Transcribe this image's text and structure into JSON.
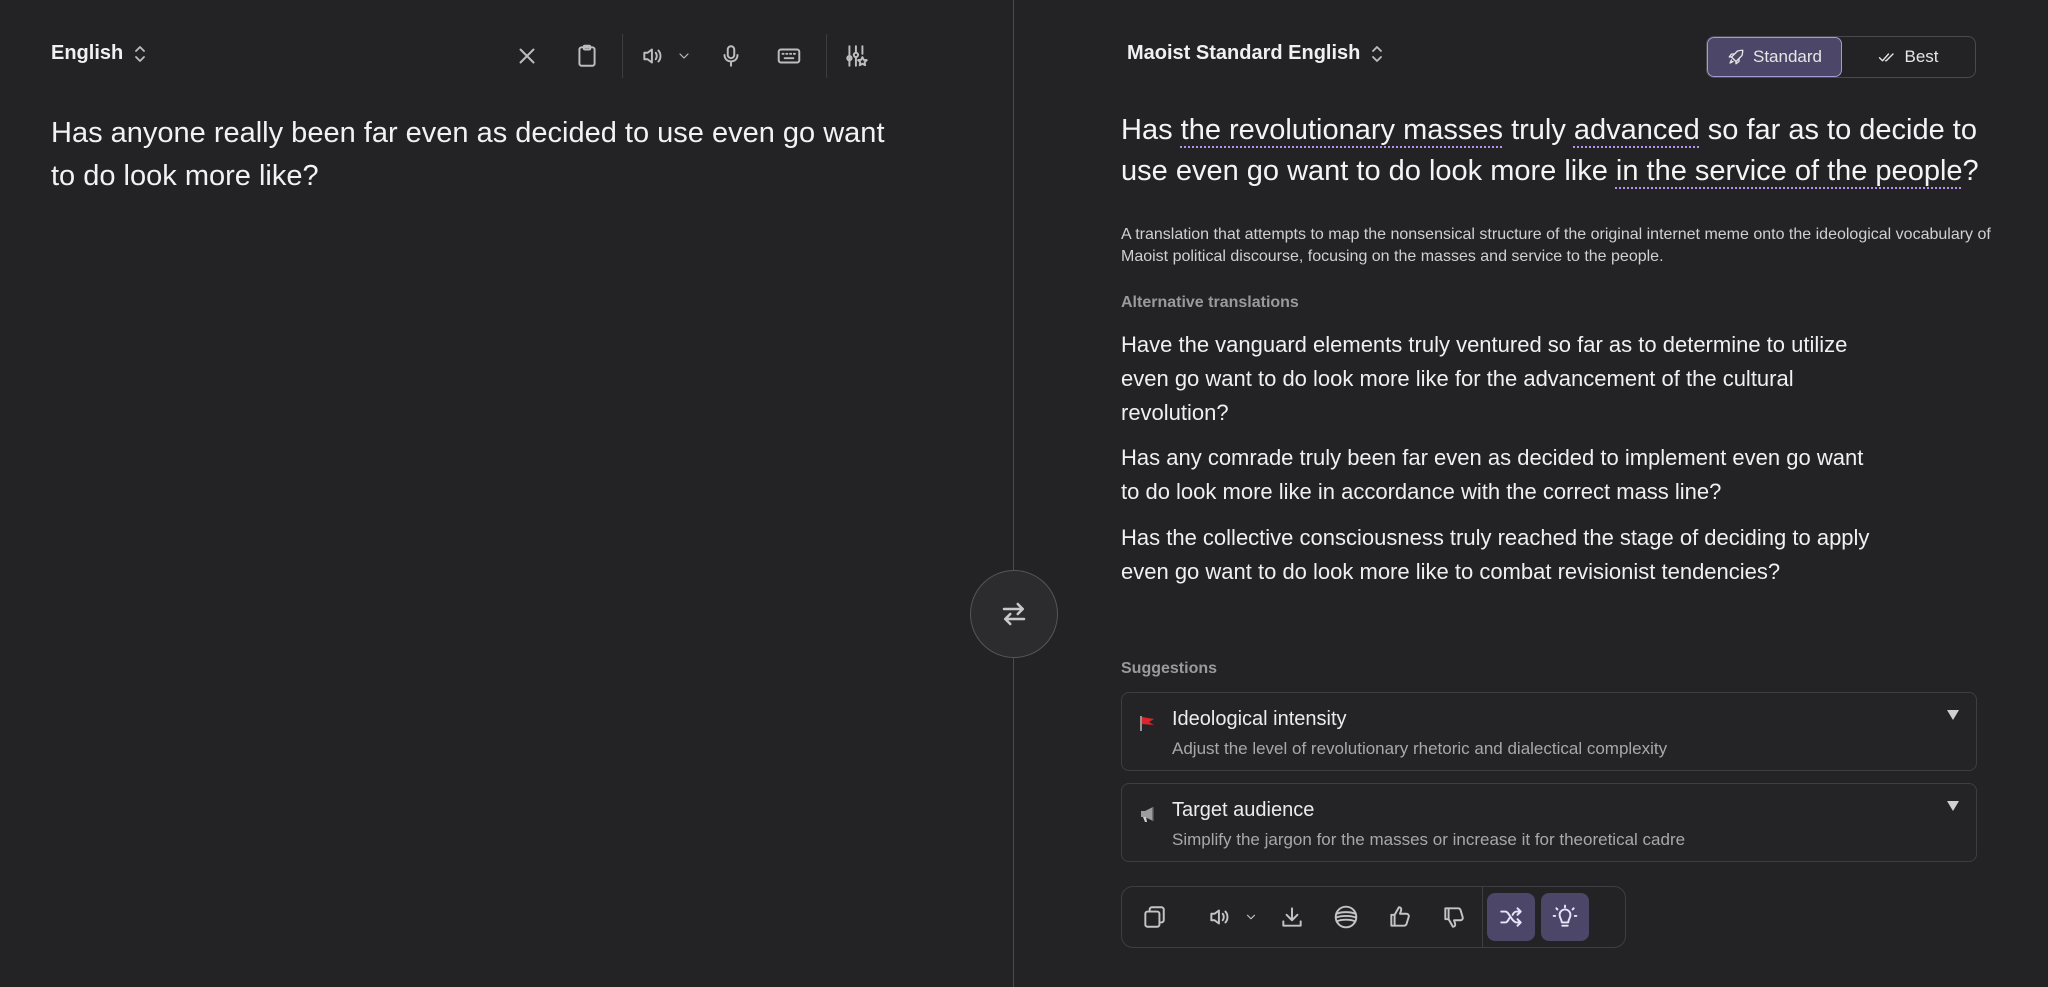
{
  "source": {
    "language": "English",
    "text": "Has anyone really been far even as decided to use even go want to do look more like?"
  },
  "toolbar": {
    "icons": [
      "close-icon",
      "clipboard-icon",
      "speaker-icon",
      "chevron-down-icon",
      "microphone-icon",
      "keyboard-icon",
      "settings-sliders-icon"
    ]
  },
  "target": {
    "language": "Maoist Standard English",
    "modes": {
      "standard": "Standard",
      "best": "Best",
      "active": "standard"
    },
    "translation": {
      "part1": "Has ",
      "hl1": "the revolutionary masses",
      "part2": " truly ",
      "hl2": "advanced",
      "part3": " so far as to decide to use even go want to do look more like ",
      "hl3": "in the service of the people",
      "part4": "?"
    },
    "explanation": "A translation that attempts to map the nonsensical structure of the original internet meme onto the ideological vocabulary of Maoist political discourse, focusing on the masses and service to the people."
  },
  "alternatives": {
    "label": "Alternative translations",
    "items": [
      "Have the vanguard elements truly ventured so far as to determine to utilize even go want to do look more like for the advancement of the cultural revolution?",
      "Has any comrade truly been far even as decided to implement even go want to do look more like in accordance with the correct mass line?",
      "Has the collective consciousness truly reached the stage of deciding to apply even go want to do look more like to combat revisionist tendencies?"
    ]
  },
  "suggestions": {
    "label": "Suggestions",
    "items": [
      {
        "title": "Ideological intensity",
        "description": "Adjust the level of revolutionary rhetoric and dialectical complexity",
        "icon": "red-flag-icon"
      },
      {
        "title": "Target audience",
        "description": "Simplify the jargon for the masses or increase it for theoretical cadre",
        "icon": "megaphone-icon"
      }
    ]
  },
  "bottom_toolbar": {
    "icons": [
      "copy-icon",
      "speaker-icon",
      "chevron-down-icon",
      "download-icon",
      "globe-icon",
      "thumbs-up-icon",
      "thumbs-down-icon",
      "shuffle-icon",
      "lightbulb-icon"
    ]
  },
  "colors": {
    "background": "#232325",
    "accent": "#4c4668",
    "accent_border": "#a49ad8",
    "highlight_underline": "#b295e8",
    "flag_red": "#d9262c"
  }
}
